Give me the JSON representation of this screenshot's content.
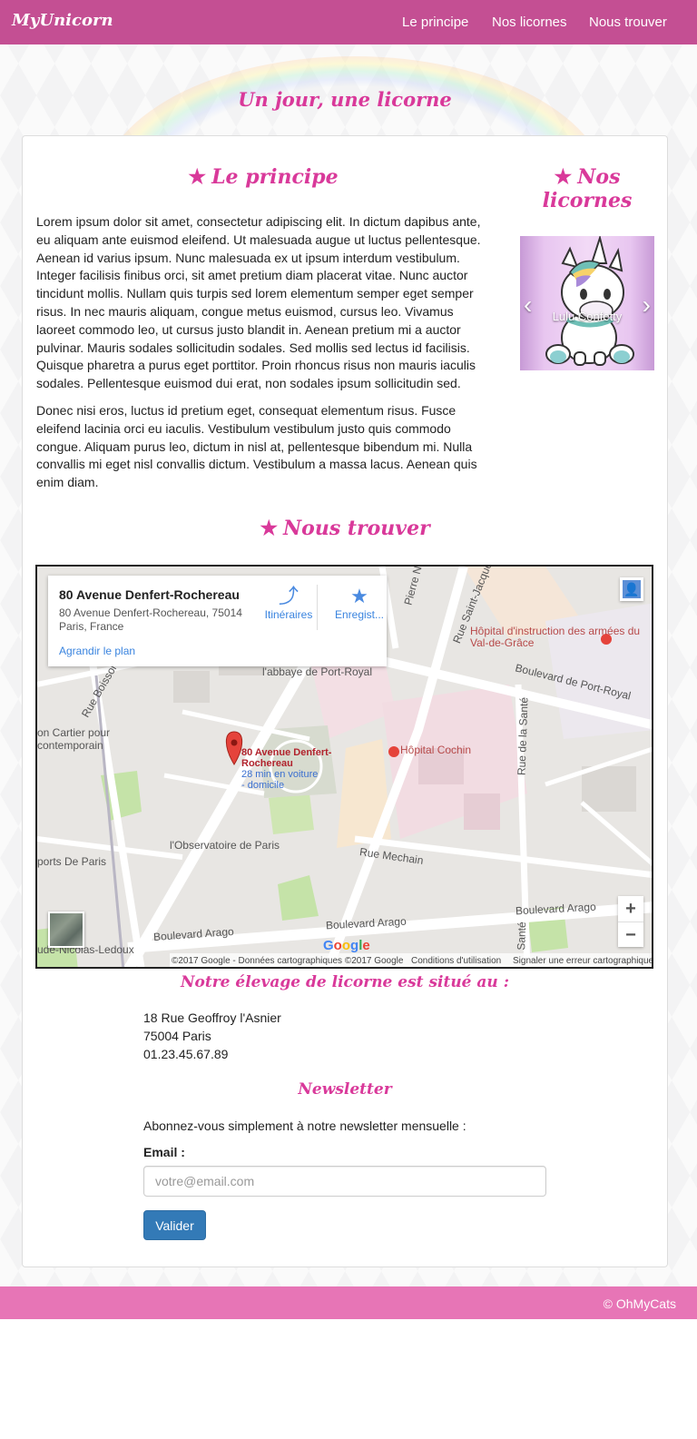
{
  "navbar": {
    "brand": "MyUnicorn",
    "links": [
      "Le principe",
      "Nos licornes",
      "Nous trouver"
    ],
    "color": "#c44f93"
  },
  "hero": {
    "title": "Un jour, une licorne"
  },
  "principe": {
    "heading": "Le principe",
    "star": "★",
    "paragraphs": [
      "Lorem ipsum dolor sit amet, consectetur adipiscing elit. In dictum dapibus ante, eu aliquam ante euismod eleifend. Ut malesuada augue ut luctus pellentesque. Aenean id varius ipsum. Nunc malesuada ex ut ipsum interdum vestibulum. Integer facilisis finibus orci, sit amet pretium diam placerat vitae. Nunc auctor tincidunt mollis. Nullam quis turpis sed lorem elementum semper eget semper risus. In nec mauris aliquam, congue metus euismod, cursus leo. Vivamus laoreet commodo leo, ut cursus justo blandit in. Aenean pretium mi a auctor pulvinar. Mauris sodales sollicitudin sodales. Sed mollis sed lectus id facilisis. Quisque pharetra a purus eget porttitor. Proin rhoncus risus non mauris iaculis sodales. Pellentesque euismod dui erat, non sodales ipsum sollicitudin sed.",
      "Donec nisi eros, luctus id pretium eget, consequat elementum risus. Fusce eleifend lacinia orci eu iaculis. Vestibulum vestibulum justo quis commodo congue. Aliquam purus leo, dictum in nisl at, pellentesque bibendum mi. Nulla convallis mi eget nisl convallis dictum. Vestibulum a massa lacus. Aenean quis enim diam."
    ]
  },
  "licornes": {
    "heading": "Nos licornes",
    "caption": "Lulu Confetty",
    "prev": "‹",
    "next": "›"
  },
  "trouver": {
    "heading": "Nous trouver",
    "map": {
      "place_title": "80 Avenue Denfert-Rochereau",
      "place_address": "80 Avenue Denfert-Rochereau, 75014 Paris, France",
      "directions_label": "Itinéraires",
      "save_label": "Enregist...",
      "enlarge_link": "Agrandir le plan",
      "marker_label": "80 Avenue Denfert-Rochereau",
      "marker_sub": "28 min en voiture - domicile",
      "zoom_in": "+",
      "zoom_out": "−",
      "google": "Google",
      "attribution": "©2017 Google - Données cartographiques ©2017 Google",
      "terms": "Conditions d'utilisation",
      "report": "Signaler une erreur cartographique",
      "labels": {
        "hopital_valdegrace": "Hôpital d'instruction des armées du Val-de-Grâce",
        "abbaye": "l'abbaye de Port-Royal",
        "bd_port_royal": "Boulevard de Port-Royal",
        "rue_boissonade": "Rue Boissonade",
        "cartier": "on Cartier pour contemporain",
        "hopital_cochin": "Hôpital Cochin",
        "rue_sante": "Rue de la Santé",
        "observatoire": "l'Observatoire de Paris",
        "rue_mechain": "Rue Mechain",
        "sports_paris": "ports De Paris",
        "bd_arago_1": "Boulevard Arago",
        "bd_arago_2": "Boulevard Arago",
        "bd_arago_3": "Boulevard Arago",
        "nicolas_ledoux": "ude-Nicolas-Ledoux",
        "rue_saint_jacques": "Rue Saint-Jacques",
        "pierre_n": "Pierre N",
        "sante_short": "Santé"
      }
    },
    "elevage_heading": "Notre élevage de licorne est situé au :",
    "address_lines": [
      "18 Rue Geoffroy l'Asnier",
      "75004 Paris",
      "01.23.45.67.89"
    ]
  },
  "newsletter": {
    "heading": "Newsletter",
    "intro": "Abonnez-vous simplement à notre newsletter mensuelle :",
    "email_label": "Email :",
    "email_placeholder": "votre@email.com",
    "submit_label": "Valider"
  },
  "footer": {
    "text": "© OhMyCats",
    "color": "#e775b6"
  },
  "colors": {
    "accent": "#d9399a",
    "button": "#337ab7"
  }
}
